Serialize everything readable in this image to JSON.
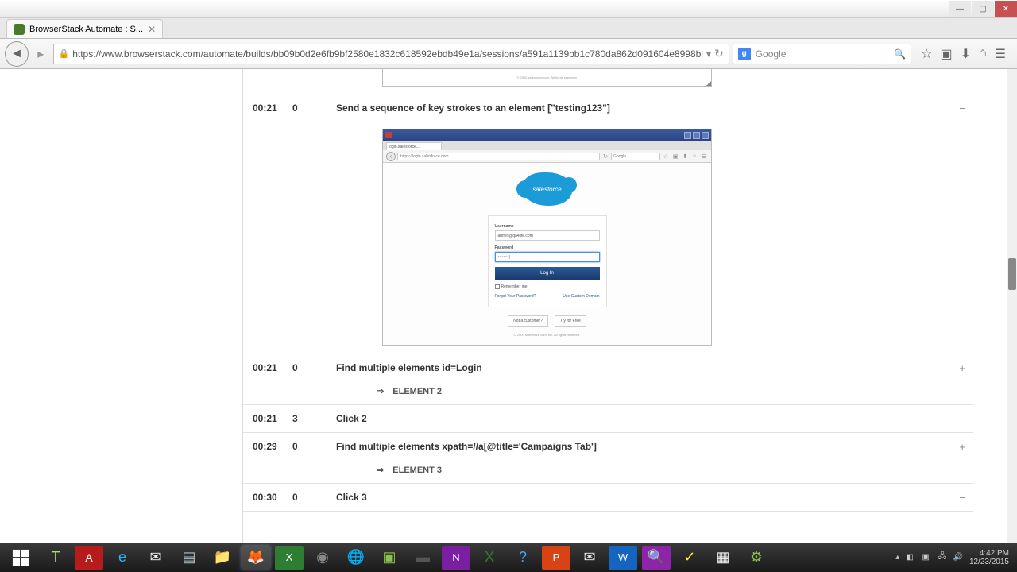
{
  "window": {
    "tab_title": "BrowserStack Automate : S...",
    "url": "https://www.browserstack.com/automate/builds/bb09b0d2e6fb9bf2580e1832c618592ebdb49e1a/sessions/a591a1139bb1c780da862d091604e8998bl",
    "search_engine": "Google"
  },
  "log": {
    "row0_footer": "© 2000 salesforce.com. All rights reserved.",
    "row1": {
      "time": "00:21",
      "dur": "0",
      "cmd": "Send a sequence of key strokes to an element   [\"testing123\"]"
    },
    "row2": {
      "time": "00:21",
      "dur": "0",
      "cmd": "Find multiple elements   id=Login",
      "sub": "ELEMENT  2"
    },
    "row3": {
      "time": "00:21",
      "dur": "3",
      "cmd": "Click   2"
    },
    "row4": {
      "time": "00:29",
      "dur": "0",
      "cmd": "Find multiple elements   xpath=//a[@title='Campaigns Tab']",
      "sub": "ELEMENT  3"
    },
    "row5": {
      "time": "00:30",
      "dur": "0",
      "cmd": "Click   3"
    }
  },
  "shot": {
    "tab": "login.salesforce...",
    "url": "https://login.salesforce.com",
    "search": "Google",
    "logo": "salesforce",
    "username_label": "Username",
    "username_value": "admin@qa4life.com",
    "password_label": "Password",
    "password_value": "••••••••|",
    "login_btn": "Log In",
    "remember": "Remember me",
    "forgot": "Forgot Your Password?",
    "custom": "Use Custom Domain",
    "not_customer": "Not a customer?",
    "try_free": "Try for Free",
    "footer": "© 2000 salesforce.com, inc. All rights reserved."
  },
  "tray": {
    "time": "4:42 PM",
    "date": "12/23/2015"
  }
}
